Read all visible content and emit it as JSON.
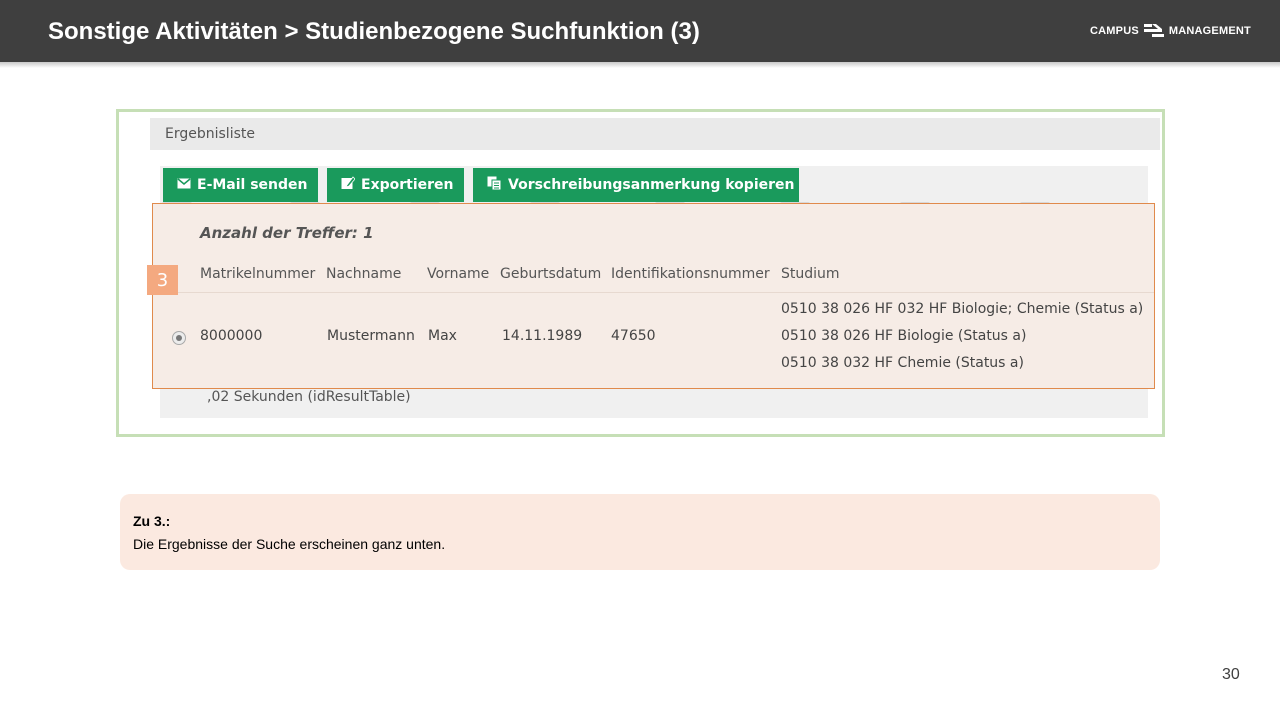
{
  "header": {
    "title": "Sonstige Aktivitäten > Studienbezogene Suchfunktion (3)",
    "logo_left": "CAMPUS",
    "logo_right": "MANAGEMENT"
  },
  "screenshot": {
    "section_label": "Ergebnisliste",
    "buttons": [
      {
        "label": "E-Mail senden",
        "icon": "envelope-icon"
      },
      {
        "label": "Exportieren",
        "icon": "export-icon"
      },
      {
        "label": "Vorschreibungsanmerkung kopieren",
        "icon": "copy-icon"
      }
    ],
    "results": {
      "count_label": "Anzahl der Treffer: 1",
      "columns": [
        "Matrikelnummer",
        "Nachname",
        "Vorname",
        "Geburtsdatum",
        "Identifikationsnummer",
        "Studium"
      ],
      "rows": [
        {
          "matrikelnummer": "8000000",
          "nachname": "Mustermann",
          "vorname": "Max",
          "geburtsdatum": "14.11.1989",
          "identifikationsnummer": "47650",
          "studium": [
            "0510 38 026 HF 032 HF Biologie; Chemie (Status a)",
            "0510 38 026 HF Biologie (Status a)",
            "0510 38 032 HF Chemie (Status a)"
          ]
        }
      ]
    },
    "timing_text": ",02 Sekunden (idResultTable)"
  },
  "step_badge": "3",
  "note": {
    "title": "Zu 3.:",
    "body": "Die Ergebnisse der Suche erscheinen ganz unten."
  },
  "page_number": "30",
  "colors": {
    "header_bg": "#3f3f3f",
    "frame_border": "#c6dfb6",
    "button_green": "#1a9a5c",
    "highlight_border": "#e08a4c",
    "badge_bg": "#f4a980",
    "note_bg": "#fbe9e0"
  }
}
